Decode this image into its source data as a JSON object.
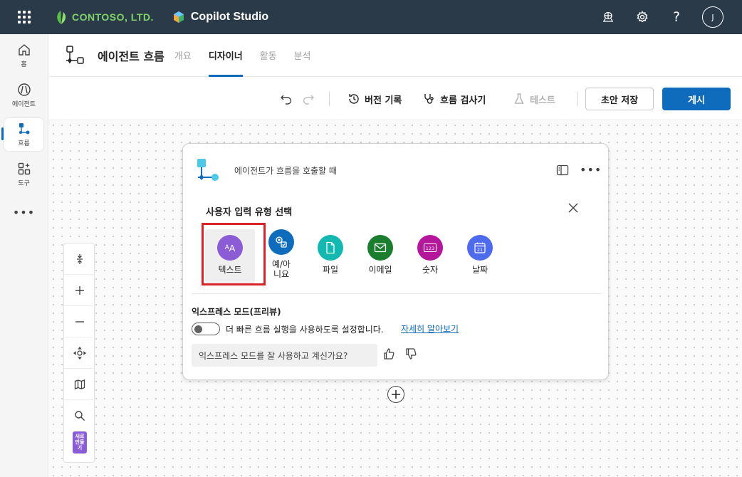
{
  "topbar": {
    "company_name": "CONTOSO, LTD.",
    "product_name": "Copilot Studio",
    "avatar_initial": "J",
    "icons": [
      "waffle-icon",
      "environment-icon",
      "settings-icon",
      "help-icon"
    ]
  },
  "rail": {
    "items": [
      {
        "label": "홈",
        "icon": "home-icon"
      },
      {
        "label": "에이전트",
        "icon": "agent-icon"
      },
      {
        "label": "흐름",
        "icon": "flow-icon",
        "active": true
      },
      {
        "label": "도구",
        "icon": "tools-icon"
      }
    ],
    "more": "•••"
  },
  "header": {
    "title": "에이전트 흐름",
    "tabs": [
      {
        "label": "개요"
      },
      {
        "label": "디자이너",
        "active": true
      },
      {
        "label": "활동"
      },
      {
        "label": "분석"
      }
    ]
  },
  "toolbar": {
    "version_history": "버전 기록",
    "flow_checker": "흐름 검사기",
    "test": "테스트",
    "save_draft": "초안 저장",
    "publish": "게시"
  },
  "zoom": {
    "new_badge": "새로\n만들\n기"
  },
  "card": {
    "trigger_text": "에이전트가 흐름을 호출할 때",
    "section_title": "사용자 입력 유형 선택",
    "input_types": [
      {
        "label": "텍스트",
        "color": "#8b5cd6",
        "icon": "text-icon",
        "selected": true
      },
      {
        "label": "예/아\n니요",
        "color": "#0f6cbd",
        "icon": "yes-no-icon"
      },
      {
        "label": "파일",
        "color": "#14b8b0",
        "icon": "file-icon"
      },
      {
        "label": "이메일",
        "color": "#1b7d2e",
        "icon": "email-icon"
      },
      {
        "label": "숫자",
        "color": "#b4179c",
        "icon": "number-icon"
      },
      {
        "label": "날짜",
        "color": "#4f6bed",
        "icon": "calendar-icon"
      }
    ],
    "express_title": "익스프레스 모드(프리뷰)",
    "express_desc": "더 빠른 흐름 실행을 사용하도록 설정합니다.",
    "learn_more": "자세히 알아보기",
    "feedback_question": "익스프레스 모드를 잘 사용하고 계신가요?"
  },
  "colors": {
    "topbar": "#2b3a48",
    "accent": "#0f6cbd",
    "highlight": "#d8232a"
  }
}
